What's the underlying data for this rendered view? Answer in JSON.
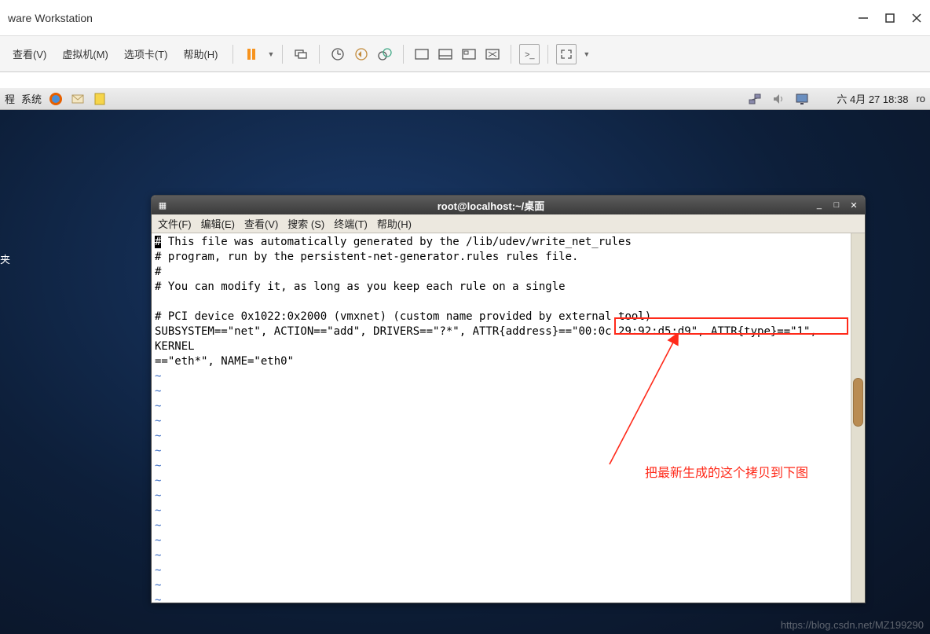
{
  "vmware": {
    "title": "ware Workstation",
    "menus": {
      "view": "查看(V)",
      "vm": "虚拟机(M)",
      "tabs": "选项卡(T)",
      "help": "帮助(H)"
    }
  },
  "guest_panel": {
    "left_items": [
      "程",
      "系统"
    ],
    "datetime": "六 4月 27 18:38",
    "user": "ro"
  },
  "desktop": {
    "folder_label": "夹"
  },
  "terminal": {
    "title": "root@localhost:~/桌面",
    "menus": {
      "file": "文件(F)",
      "edit": "编辑(E)",
      "view": "查看(V)",
      "search": "搜索 (S)",
      "terminal": "终端(T)",
      "help": "帮助(H)"
    },
    "lines": {
      "l1": "# This file was automatically generated by the /lib/udev/write_net_rules",
      "l2": "# program, run by the persistent-net-generator.rules rules file.",
      "l3": "#",
      "l4": "# You can modify it, as long as you keep each rule on a single",
      "l5": "",
      "l6": "# PCI device 0x1022:0x2000 (vmxnet) (custom name provided by external tool)",
      "l7a": "SUBSYSTEM==\"net\", ACTION==\"add\", DRIVERS==\"?*\", ",
      "l7b": "ATTR{address}==\"00:0c:29:92:d5:d9\",",
      "l7c": " ATTR{type}==\"1\", KERNEL",
      "l8": "==\"eth*\", NAME=\"eth0\""
    }
  },
  "annotation": {
    "text": "把最新生成的这个拷贝到下图"
  },
  "watermark": "https://blog.csdn.net/MZ199290"
}
